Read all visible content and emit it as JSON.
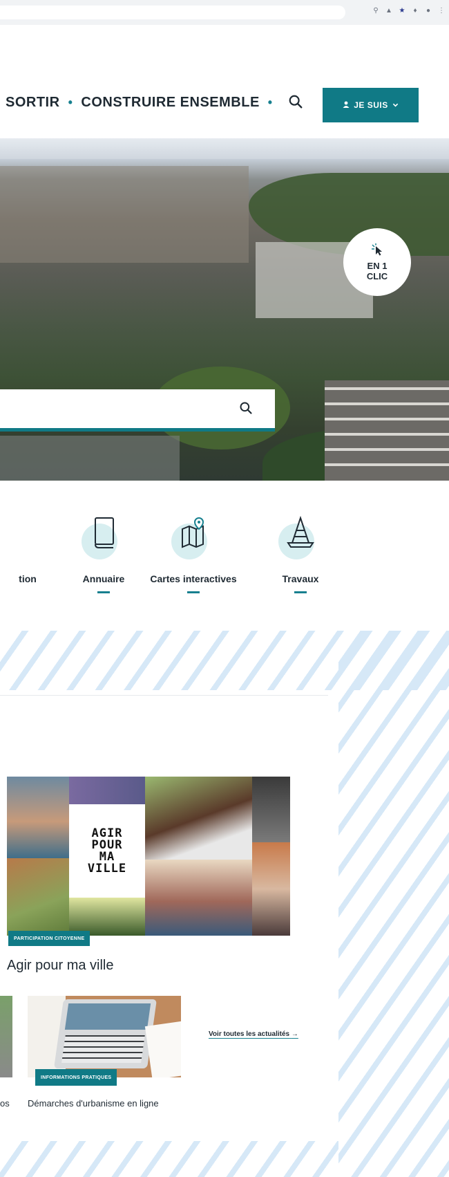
{
  "nav": {
    "items": [
      "SORTIR",
      "CONSTRUIRE ENSEMBLE"
    ],
    "jesuis_label": "JE SUIS",
    "accent": "#107a86"
  },
  "hero": {
    "clic_line1": "EN 1",
    "clic_line2": "CLIC",
    "search_placeholder": ""
  },
  "quick_links": [
    {
      "label": "tion",
      "icon": "participation-icon"
    },
    {
      "label": "Annuaire",
      "icon": "book-icon"
    },
    {
      "label": "Cartes interactives",
      "icon": "map-pin-icon"
    },
    {
      "label": "Travaux",
      "icon": "traffic-cone-icon"
    }
  ],
  "news": {
    "main_category": "PARTICIPATION CITOYENNE",
    "main_title": "Agir pour ma ville",
    "agir_lines": [
      "AGIR",
      "POUR",
      "MA",
      "VILLE"
    ],
    "small_category": "INFORMATIONS PRATIQUES",
    "small_title": "Démarches d'urbanisme en ligne",
    "left_partial_title": "os",
    "see_all": "Voir toutes les actualités",
    "see_all_arrow": "→"
  }
}
